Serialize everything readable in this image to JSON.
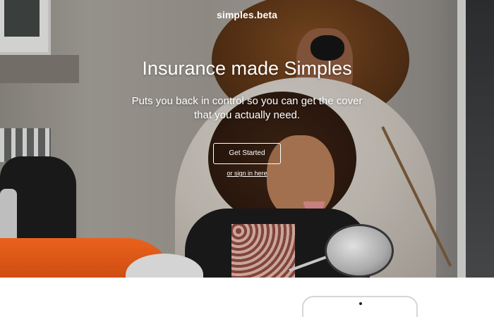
{
  "header": {
    "logo_text": "simples",
    "logo_dot": ".",
    "logo_suffix": "beta"
  },
  "hero": {
    "headline": "Insurance made Simples",
    "subtext": "Puts you back in control so you can get the cover that you actually need.",
    "cta_label": "Get Started",
    "signin_label": "or sign in here"
  },
  "colors": {
    "text": "#ffffff",
    "background": "#ffffff"
  },
  "icons": {
    "device": "phone-mockup-icon"
  }
}
